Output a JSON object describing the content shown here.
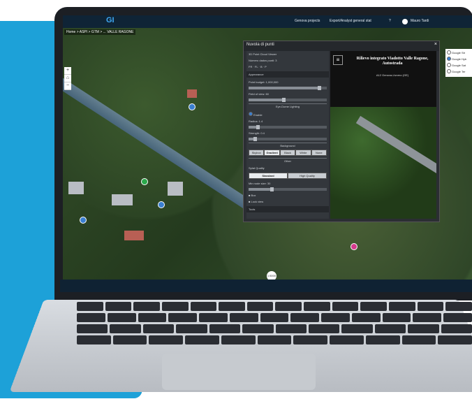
{
  "app": {
    "logo": "GI",
    "breadcrumb": "Home > ASPI > GTM > ... VALLE RAGONE",
    "topbar": {
      "item1": "Genova projects",
      "item2": "Export/Analyst general stat",
      "item3": "?",
      "user": "Mauro Tardi"
    }
  },
  "map": {
    "zoom_in": "+",
    "home": "⌂",
    "zoom_out": "−",
    "scale_label": "1:5000"
  },
  "layers": {
    "items": [
      {
        "label": "Google Str",
        "selected": false
      },
      {
        "label": "Google Hyb",
        "selected": true
      },
      {
        "label": "Google Sat",
        "selected": false
      },
      {
        "label": "Google Ter",
        "selected": false
      }
    ]
  },
  "dialog": {
    "title": "Nuvola di punti",
    "close": "×",
    "panel": {
      "header": "3D Point Cloud Viewer",
      "num_points_label": "Número dados punti: 3",
      "view_buttons": "FR · FL · B · P",
      "appearance_label": "Appearance",
      "point_budget_label": "Point budget: 1,000,000",
      "fov_label": "Field of view: 60",
      "lighting_section": "Eye-Dome Lighting",
      "enable_label": "Enable",
      "radius_label": "Radius: 1.4",
      "strength_label": "Strength: 0.4",
      "background_section": "Background",
      "bg_options": [
        "Skybox",
        "Gradient",
        "Black",
        "White",
        "None"
      ],
      "bg_selected": 1,
      "other_section": "Other",
      "splat_quality_label": "Splat Quality",
      "splat_options": [
        "Standard",
        "High Quality"
      ],
      "splat_selected": 0,
      "min_node_label": "Min node size: 30",
      "box_label": "Box",
      "lock_view_label": "Lock view",
      "tools_label": "Tools"
    },
    "view": {
      "title": "Rilievo integrato Viadotto Valle Ragone, Autostrada",
      "subtitle": "A12 Genova-Livorno (GE)"
    }
  },
  "colors": {
    "accent": "#1da1d8",
    "topbar": "#0f2436",
    "dialog": "#2b2e33"
  }
}
